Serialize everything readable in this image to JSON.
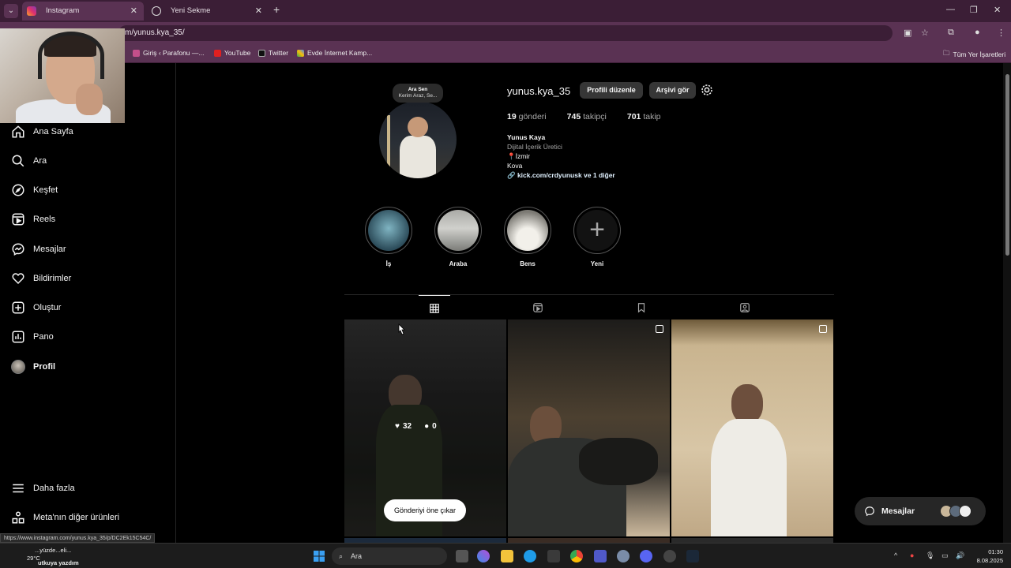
{
  "browser": {
    "tabs": [
      {
        "title": "Instagram",
        "active": true
      },
      {
        "title": "Yeni Sekme",
        "active": false
      }
    ],
    "url": "m/yunus.kya_35/",
    "bookmarks": [
      "Giriş ‹ Parafonu —...",
      "YouTube",
      "Twitter",
      "Evde İnternet Kamp...",
      "Tüm Yer İşaretleri"
    ],
    "status_url": "https://www.instagram.com/yunus.kya_35/p/DC2Ek15C54C/"
  },
  "sidebar": {
    "items": [
      {
        "label": "Ana Sayfa",
        "icon": "home-icon"
      },
      {
        "label": "Ara",
        "icon": "search-icon"
      },
      {
        "label": "Keşfet",
        "icon": "compass-icon"
      },
      {
        "label": "Reels",
        "icon": "reels-icon"
      },
      {
        "label": "Mesajlar",
        "icon": "messenger-icon"
      },
      {
        "label": "Bildirimler",
        "icon": "heart-icon"
      },
      {
        "label": "Oluştur",
        "icon": "plus-square-icon"
      },
      {
        "label": "Pano",
        "icon": "chart-icon"
      },
      {
        "label": "Profil",
        "icon": "avatar"
      }
    ],
    "more": "Daha fazla",
    "meta": "Meta'nın diğer ürünleri"
  },
  "profile": {
    "username": "yunus.kya_35",
    "edit_button": "Profili düzenle",
    "archive_button": "Arşivi gör",
    "note": {
      "line1": "Ara Sen",
      "line2": "Kerim Araz, Se..."
    },
    "stats": {
      "posts_count": "19",
      "posts_label": "gönderi",
      "followers_count": "745",
      "followers_label": "takipçi",
      "following_count": "701",
      "following_label": "takip"
    },
    "bio": {
      "name": "Yunus Kaya",
      "category": "Dijital İçerik Üretici",
      "location": "İzmir",
      "line": "Kova",
      "link": "kick.com/crdyunusk ve 1 diğer"
    }
  },
  "highlights": [
    {
      "label": "İş"
    },
    {
      "label": "Araba"
    },
    {
      "label": "Bens"
    },
    {
      "label": "Yeni"
    }
  ],
  "posts": {
    "hover": {
      "likes": "32",
      "comments": "0"
    },
    "feature_button": "Gönderiyi öne çıkar"
  },
  "messages_pill": {
    "label": "Mesajlar"
  },
  "taskbar": {
    "search": "Ara",
    "weather_line1": "...yüzde...eli...",
    "weather_line2": "29°C",
    "notif_line": "utkuya yazdım",
    "time": "01:30",
    "date": "8.08.2025"
  },
  "colors": {
    "accent": "#0095f6",
    "tab_bg": "#3b1e36",
    "toolbar_bg": "#5a3253"
  }
}
